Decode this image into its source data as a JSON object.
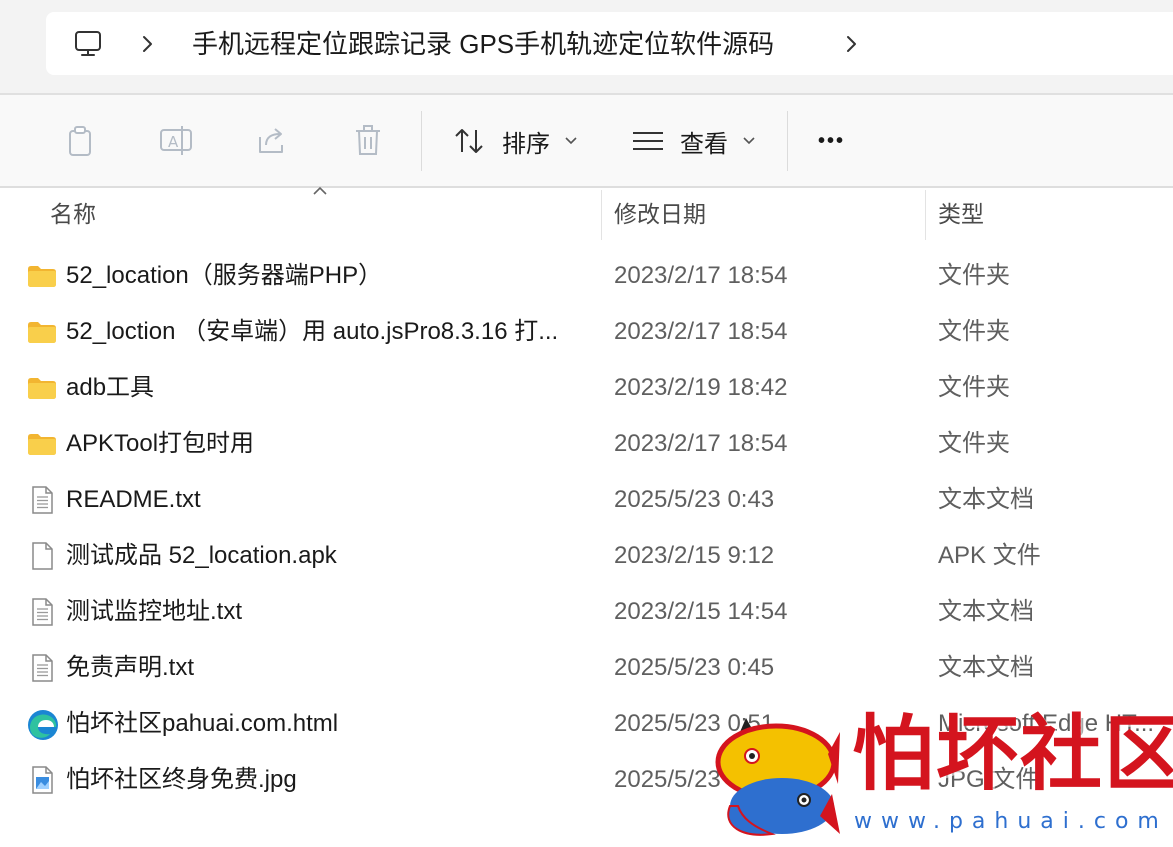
{
  "address_bar": {
    "path": "手机远程定位跟踪记录 GPS手机轨迹定位软件源码",
    "computer_icon": "computer-icon",
    "separator_icon": "chevron-right-icon"
  },
  "toolbar": {
    "copy_icon": "copy-icon",
    "rename_icon": "rename-icon",
    "share_icon": "share-icon",
    "delete_icon": "delete-icon",
    "sort_label": "排序",
    "view_label": "查看",
    "more_label": "•••"
  },
  "columns": {
    "name": "名称",
    "date": "修改日期",
    "type": "类型"
  },
  "files": [
    {
      "name": "52_location（服务器端PHP）",
      "date": "2023/2/17 18:54",
      "type": "文件夹",
      "icon": "folder-icon"
    },
    {
      "name": "52_loction （安卓端）用 auto.jsPro8.3.16 打...",
      "date": "2023/2/17 18:54",
      "type": "文件夹",
      "icon": "folder-icon"
    },
    {
      "name": "adb工具",
      "date": "2023/2/19 18:42",
      "type": "文件夹",
      "icon": "folder-icon"
    },
    {
      "name": "APKTool打包时用",
      "date": "2023/2/17 18:54",
      "type": "文件夹",
      "icon": "folder-icon"
    },
    {
      "name": "README.txt",
      "date": "2025/5/23 0:43",
      "type": "文本文档",
      "icon": "text-file-icon"
    },
    {
      "name": "测试成品 52_location.apk",
      "date": "2023/2/15 9:12",
      "type": "APK 文件",
      "icon": "blank-file-icon"
    },
    {
      "name": "测试监控地址.txt",
      "date": "2023/2/15 14:54",
      "type": "文本文档",
      "icon": "text-file-icon"
    },
    {
      "name": "免责声明.txt",
      "date": "2025/5/23 0:45",
      "type": "文本文档",
      "icon": "text-file-icon"
    },
    {
      "name": "怕坏社区pahuai.com.html",
      "date": "2025/5/23 0:51",
      "type": "Microsoft Edge HT...",
      "icon": "edge-icon"
    },
    {
      "name": "怕坏社区终身免费.jpg",
      "date": "2025/5/23 0:51",
      "type": "JPG 文件",
      "icon": "image-file-icon"
    }
  ],
  "watermark": {
    "title": "怕坏社区",
    "url": "www.pahuai.com"
  },
  "colors": {
    "folder": "#f7c948",
    "watermark_red": "#d4141e",
    "watermark_blue": "#2e6fcf"
  }
}
